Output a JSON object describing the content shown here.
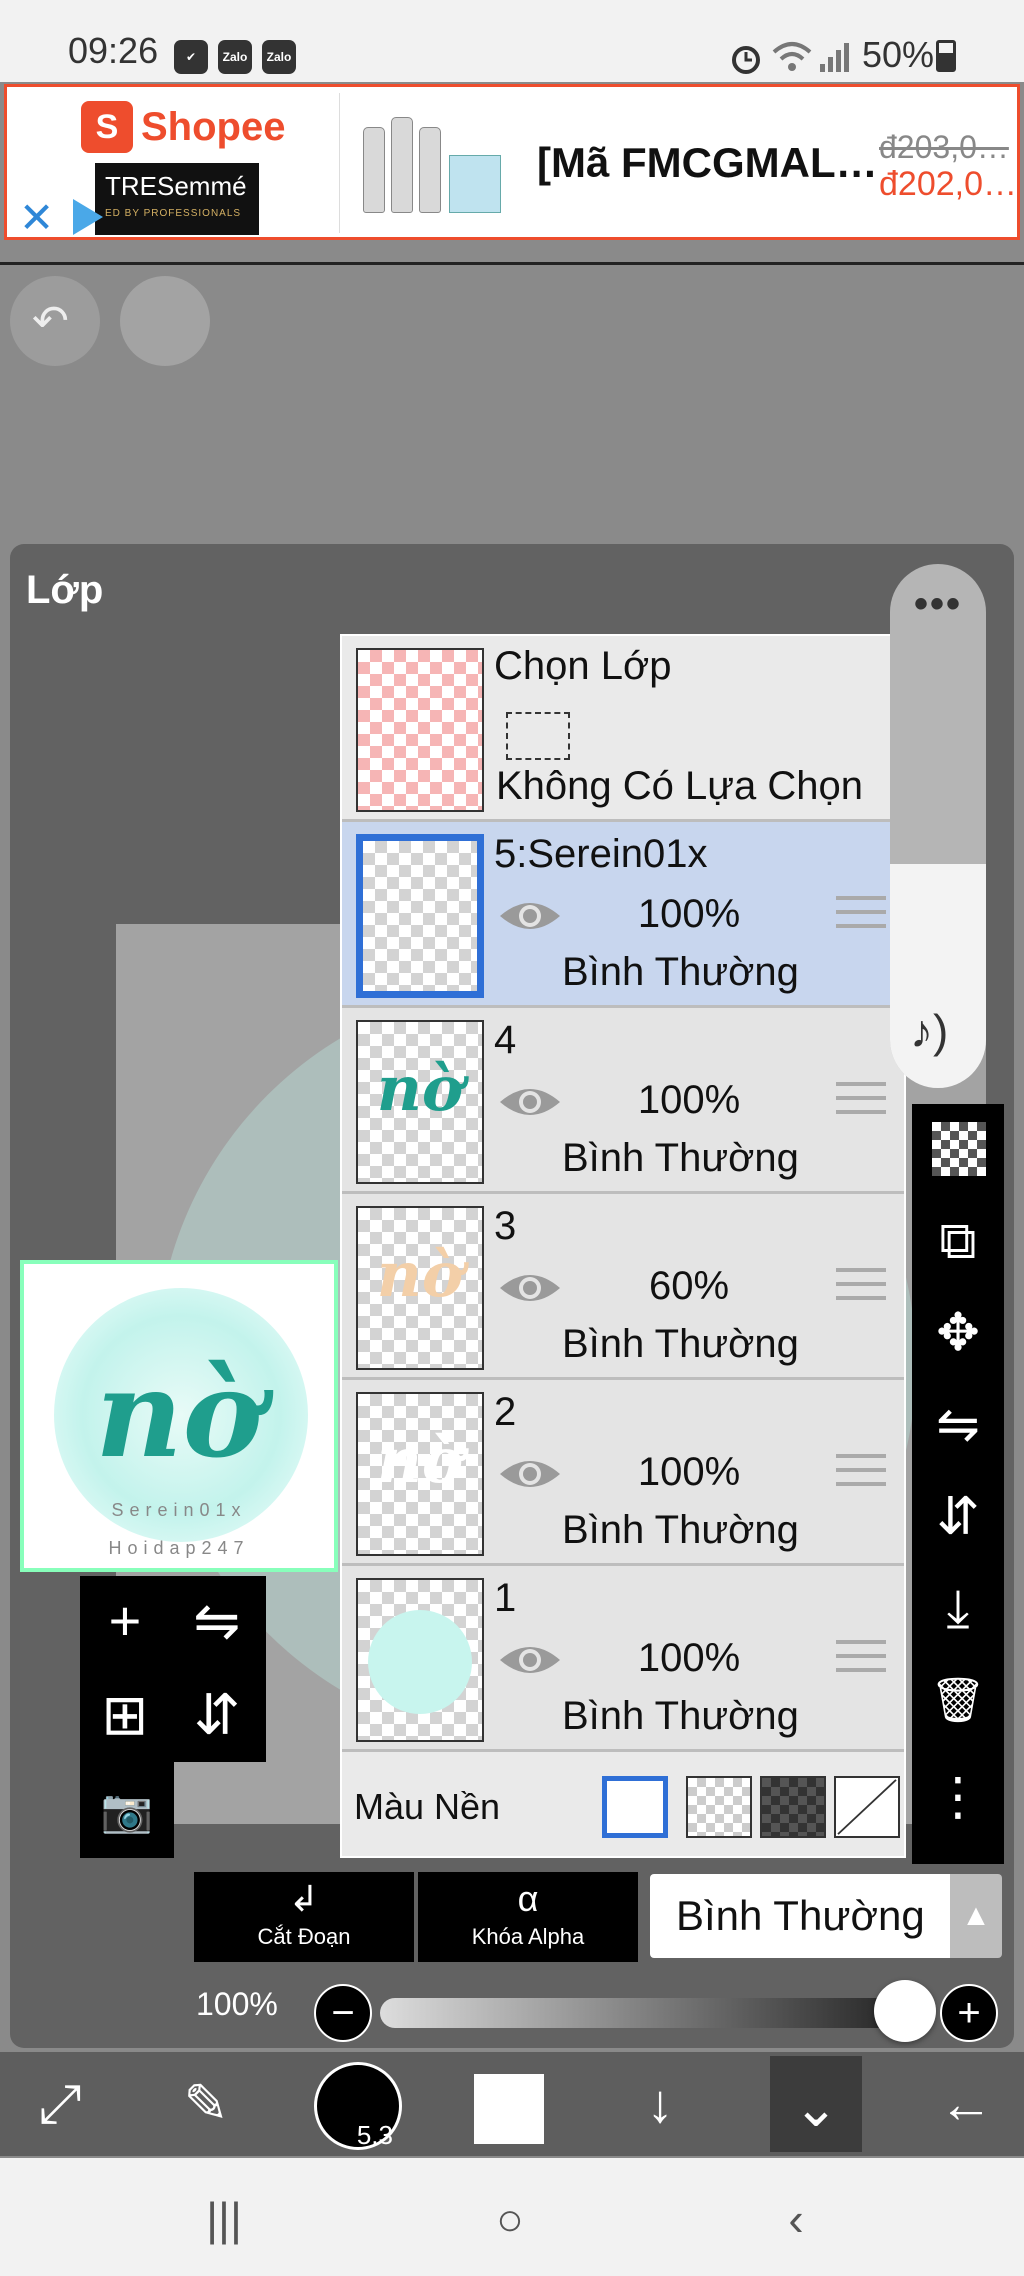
{
  "status_bar": {
    "time": "09:26",
    "app_icons": [
      "✔",
      "Zalo",
      "Zalo"
    ],
    "battery": "50%"
  },
  "ad": {
    "brand": "Shopee",
    "shopee_glyph": "S",
    "product_brand": "TRESemmé",
    "product_tag": "ED BY PROFESSIONALS",
    "headline": "[Mã FMCGMAL…",
    "old_price": "đ203,0…",
    "new_price": "đ202,0…",
    "close_symbol": "✕"
  },
  "canvas": {
    "undo_symbol": "↶"
  },
  "layers_panel": {
    "title": "Lớp",
    "preview": {
      "art_text": "nờ",
      "credit_line1": "Serein01x",
      "credit_line2": "Hoidap247"
    },
    "selection_row": {
      "title": "Chọn Lớp",
      "status": "Không Có Lựa Chọn"
    },
    "layers": [
      {
        "name": "5:Serein01x",
        "opacity": "100%",
        "blend": "Bình Thường",
        "selected": true,
        "thumb_text": ""
      },
      {
        "name": "4",
        "opacity": "100%",
        "blend": "Bình Thường",
        "selected": false,
        "thumb_text": "nờ"
      },
      {
        "name": "3",
        "opacity": "60%",
        "blend": "Bình Thường",
        "selected": false,
        "thumb_text": "nờ"
      },
      {
        "name": "2",
        "opacity": "100%",
        "blend": "Bình Thường",
        "selected": false,
        "thumb_text": "nờ"
      },
      {
        "name": "1",
        "opacity": "100%",
        "blend": "Bình Thường",
        "selected": false,
        "thumb_text": ""
      }
    ],
    "background_row": {
      "label": "Màu Nền"
    },
    "scroll_widget": {
      "more_symbol": "•••",
      "sound_symbol": "♪)"
    },
    "controls": {
      "clip_label": "Cắt Đoạn",
      "clip_icon": "↲",
      "alpha_lock_label": "Khóa Alpha",
      "alpha_lock_icon": "α",
      "blend_mode": "Bình Thường",
      "blend_arrow": "▲",
      "opacity_value": "100%",
      "minus": "−",
      "plus": "+"
    },
    "left_tools": {
      "add": "+",
      "add_folder": "⊞",
      "camera": "📷",
      "flip_h": "⇋",
      "flip_v": "⇵"
    },
    "right_tools": {
      "copy": "⧉",
      "move": "✥",
      "flip_h": "⇋",
      "flip_v": "⇵",
      "merge_down": "⤓",
      "delete": "🗑",
      "more": "⋮"
    }
  },
  "bottom_toolbar": {
    "transform_icon": "⤢",
    "brush_icon": "✎",
    "brush_size": "5.3",
    "down_icon": "↓",
    "layers_icon": "⌄",
    "back_icon": "←"
  },
  "nav_bar": {
    "recent": "|||",
    "home": "○",
    "back": "‹"
  }
}
